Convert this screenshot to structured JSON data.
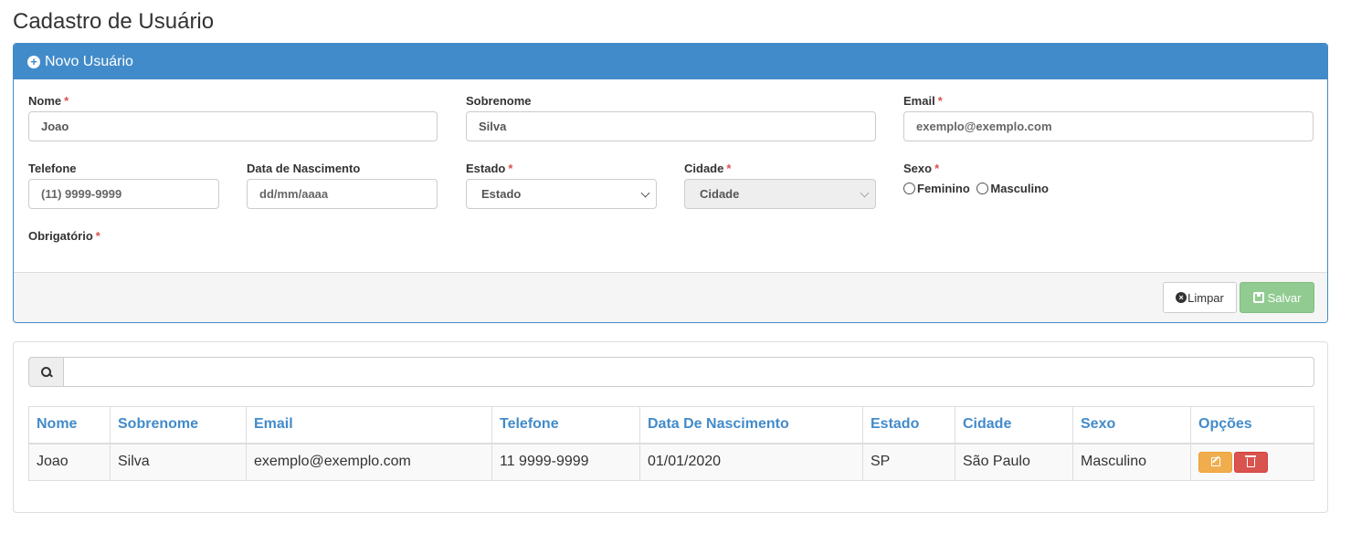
{
  "page_title": "Cadastro de Usuário",
  "form_panel": {
    "heading": "Novo Usuário",
    "fields": {
      "nome": {
        "label": "Nome",
        "required": "*",
        "value": "Joao"
      },
      "sobrenome": {
        "label": "Sobrenome",
        "value": "Silva"
      },
      "email": {
        "label": "Email",
        "required": "*",
        "placeholder": "exemplo@exemplo.com"
      },
      "telefone": {
        "label": "Telefone",
        "placeholder": "(11) 9999-9999"
      },
      "data_nascimento": {
        "label": "Data de Nascimento",
        "placeholder": "dd/mm/aaaa"
      },
      "estado": {
        "label": "Estado",
        "required": "*",
        "selected": "Estado"
      },
      "cidade": {
        "label": "Cidade",
        "required": "*",
        "selected": "Cidade"
      },
      "sexo": {
        "label": "Sexo",
        "required": "*",
        "options": [
          "Feminino",
          "Masculino"
        ]
      }
    },
    "obrigatorio": {
      "label": "Obrigatório",
      "required": "*"
    },
    "buttons": {
      "limpar": "Limpar",
      "salvar": "Salvar"
    }
  },
  "table": {
    "headers": [
      "Nome",
      "Sobrenome",
      "Email",
      "Telefone",
      "Data De Nascimento",
      "Estado",
      "Cidade",
      "Sexo",
      "Opções"
    ],
    "rows": [
      [
        "Joao",
        "Silva",
        "exemplo@exemplo.com",
        "11 9999-9999",
        "01/01/2020",
        "SP",
        "São Paulo",
        "Masculino"
      ]
    ]
  },
  "colors": {
    "primary": "#428bca",
    "success_disabled": "#91cb91",
    "warning": "#f0ad4e",
    "danger": "#d9534f"
  },
  "icons": [
    "plus-circle-icon",
    "times-circle-icon",
    "floppy-icon",
    "search-icon",
    "edit-icon",
    "trash-icon",
    "chevron-down-icon"
  ]
}
